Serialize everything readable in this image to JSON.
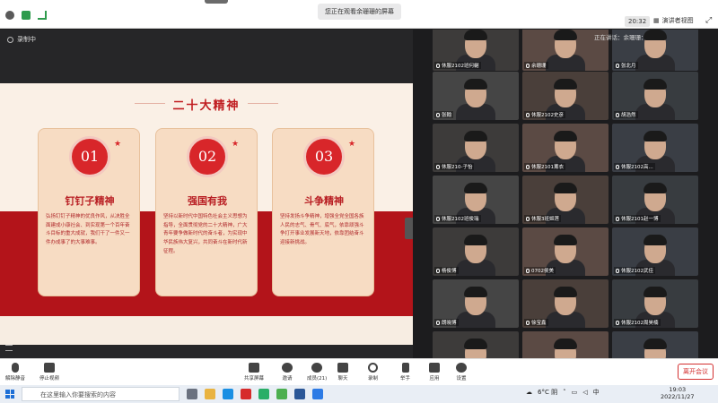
{
  "window": {
    "title": "您正在观看余珊珊的屏幕",
    "time": "20:32",
    "view_label": "演讲者视图",
    "recording": "录制中"
  },
  "slide": {
    "title": "二十大精神",
    "cards": [
      {
        "num": "01",
        "heading": "钉钉子精神",
        "body": "弘扬钉钉子精神的优良作风，从决胜全面建成小康社会、到实现第一个百年奋斗目标的重大成就，我们干了一件又一件办成事了的大事难事。"
      },
      {
        "num": "02",
        "heading": "强国有我",
        "body": "坚持以新时代中国特色社会主义思想为指导，全面贯彻党的二十大精神，广大青年要争做新时代的奋斗者，为实现中华民族伟大复兴，共同奋斗在新时代新征程。"
      },
      {
        "num": "03",
        "heading": "斗争精神",
        "body": "坚持发扬斗争精神，增强全党全国各族人民的志气、骨气、底气，依靠顽强斗争打开事业发展新天地，依靠团结奋斗迎接新挑战。"
      }
    ]
  },
  "participants": [
    {
      "name": "休服2102班何樾"
    },
    {
      "name": "余珊珊"
    },
    {
      "name": "张北月"
    },
    {
      "name": "张翰"
    },
    {
      "name": "休服2102史彦"
    },
    {
      "name": "胡浩然"
    },
    {
      "name": "休服210-子怡"
    },
    {
      "name": "休服2101薰衣"
    },
    {
      "name": "休服2102高..."
    },
    {
      "name": "休服2102班俊瑞"
    },
    {
      "name": "休服3班姬莲"
    },
    {
      "name": "休服2101赵一博"
    },
    {
      "name": "杨俊博"
    },
    {
      "name": "0702侯美"
    },
    {
      "name": "休服2102武佳"
    },
    {
      "name": "朗晓博"
    },
    {
      "name": "徐宝鑫"
    },
    {
      "name": "休服2102周昊楠"
    },
    {
      "name": ""
    },
    {
      "name": ""
    },
    {
      "name": ""
    }
  ],
  "speaking": "正在讲话：余珊珊：",
  "toolbar": {
    "mute": "解除静音",
    "stop_video": "停止视频",
    "share": "共享屏幕",
    "invite": "邀请",
    "members": "成员(21)",
    "chat": "聊天",
    "record": "录制",
    "raise": "举手",
    "apps": "应用",
    "settings": "设置",
    "end": "离开会议"
  },
  "taskbar": {
    "search_placeholder": "在这里输入你要搜索的内容",
    "weather": "6°C 阴",
    "ime": "中",
    "clock_time": "19:03",
    "clock_date": "2022/11/27"
  }
}
